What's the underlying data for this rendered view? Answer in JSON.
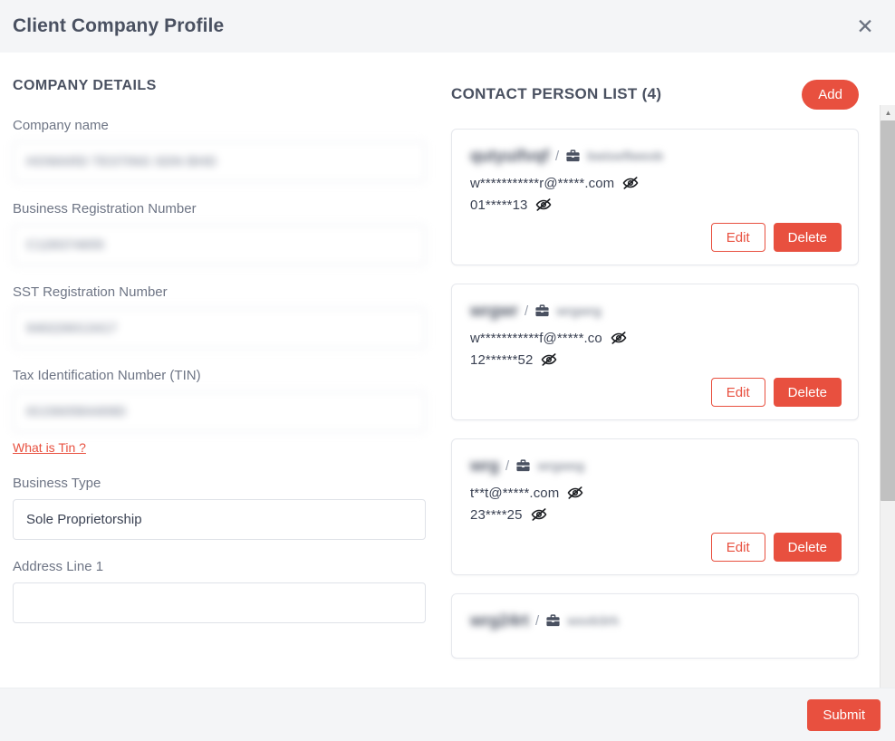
{
  "header": {
    "title": "Client Company Profile",
    "close_label": "✕"
  },
  "company_details": {
    "section_title": "COMPANY DETAILS",
    "fields": [
      {
        "label": "Company name",
        "value": "HOWARD TESTING SDN BHD",
        "redacted": true
      },
      {
        "label": "Business Registration Number",
        "value": "C128374655",
        "redacted": true
      },
      {
        "label": "SST Registration Number",
        "value": "940226013417",
        "redacted": true
      },
      {
        "label": "Tax Identification Number (TIN)",
        "value": "IG1560584409D",
        "redacted": true
      },
      {
        "label": "Business Type",
        "value": "Sole Proprietorship",
        "redacted": false
      },
      {
        "label": "Address Line 1",
        "value": "",
        "redacted": false
      }
    ],
    "tin_help_link": "What is Tin ?"
  },
  "contacts": {
    "title": "CONTACT PERSON LIST (4)",
    "add_label": "Add",
    "edit_label": "Edit",
    "delete_label": "Delete",
    "items": [
      {
        "name": "qutyuifvqf",
        "job_title": "bwioeflweob",
        "email": "w***********r@*****.com",
        "phone": "01*****13"
      },
      {
        "name": "wrgwr",
        "job_title": "wrgwrg",
        "email": "w***********f@*****.co",
        "phone": "12******52"
      },
      {
        "name": "wrg",
        "job_title": "wrgweg",
        "email": "t**t@*****.com",
        "phone": "23****25"
      },
      {
        "name": "wrg24rt",
        "job_title": "wsvb3rh",
        "email": "",
        "phone": ""
      }
    ]
  },
  "footer": {
    "submit_label": "Submit"
  },
  "scrollbar": {
    "up_arrow": "▲",
    "down_arrow": "▼"
  },
  "colors": {
    "accent": "#e8503f",
    "header_bg": "#f4f5f7",
    "text": "#4a5161",
    "label": "#6e7585"
  }
}
